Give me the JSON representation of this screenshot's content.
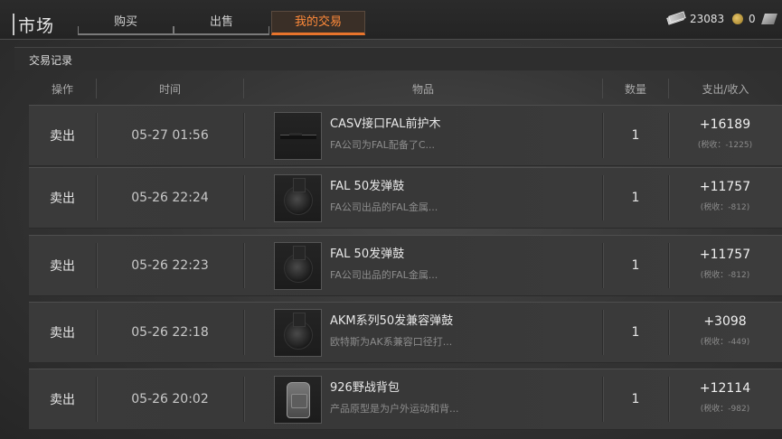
{
  "header": {
    "title": "市场",
    "tabs": [
      {
        "label": "购买"
      },
      {
        "label": "出售"
      },
      {
        "label": "我的交易"
      }
    ],
    "currency": {
      "bills": "23083",
      "coins": "0",
      "icons": [
        "bills-icon",
        "coin-icon",
        "add-currency-icon"
      ]
    }
  },
  "section": {
    "title": "交易记录"
  },
  "columns": {
    "operation": "操作",
    "time": "时间",
    "item": "物品",
    "quantity": "数量",
    "amount": "支出/收入"
  },
  "rows": [
    {
      "op": "卖出",
      "time": "05-27 01:56",
      "name": "CASV接口FAL前护木",
      "desc": "FA公司为FAL配备了C...",
      "qty": "1",
      "amount": "+16189",
      "tax": "(税收：-1225)",
      "icon": "handguard-icon"
    },
    {
      "op": "卖出",
      "time": "05-26 22:24",
      "name": "FAL 50发弹鼓",
      "desc": "FA公司出品的FAL金属...",
      "qty": "1",
      "amount": "+11757",
      "tax": "(税收：-812)",
      "icon": "drum-magazine-icon"
    },
    {
      "op": "卖出",
      "time": "05-26 22:23",
      "name": "FAL 50发弹鼓",
      "desc": "FA公司出品的FAL金属...",
      "qty": "1",
      "amount": "+11757",
      "tax": "(税收：-812)",
      "icon": "drum-magazine-icon"
    },
    {
      "op": "卖出",
      "time": "05-26 22:18",
      "name": "AKM系列50发兼容弹鼓",
      "desc": "欧特斯为AK系兼容口径打...",
      "qty": "1",
      "amount": "+3098",
      "tax": "(税收：-449)",
      "icon": "drum-magazine-icon"
    },
    {
      "op": "卖出",
      "time": "05-26 20:02",
      "name": "926野战背包",
      "desc": "产品原型是为户外运动和背...",
      "qty": "1",
      "amount": "+12114",
      "tax": "(税收：-982)",
      "icon": "backpack-icon"
    }
  ]
}
